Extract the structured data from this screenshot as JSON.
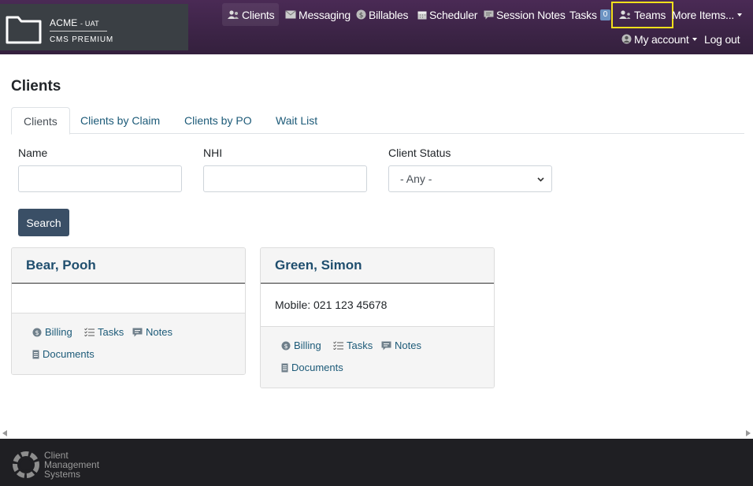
{
  "brand": {
    "org": "ACME",
    "env": "- UAT",
    "product": "CMS PREMIUM"
  },
  "nav": {
    "clients": "Clients",
    "messaging": "Messaging",
    "billables": "Billables",
    "scheduler": "Scheduler",
    "session_notes": "Session Notes",
    "tasks": "Tasks",
    "tasks_count": "0",
    "teams": "Teams",
    "more_items": "More Items...",
    "my_account": "My account",
    "log_out": "Log out"
  },
  "page": {
    "title": "Clients"
  },
  "tabs": [
    "Clients",
    "Clients by Claim",
    "Clients by PO",
    "Wait List"
  ],
  "filters": {
    "name_label": "Name",
    "name_value": "",
    "nhi_label": "NHI",
    "nhi_value": "",
    "status_label": "Client Status",
    "status_selected": "- Any -"
  },
  "search_label": "Search",
  "cards": [
    {
      "name": "Bear, Pooh",
      "detail": "",
      "links": {
        "billing": "Billing",
        "tasks": "Tasks",
        "notes": "Notes",
        "documents": "Documents"
      }
    },
    {
      "name": "Green, Simon",
      "detail": "Mobile: 021 123 45678",
      "links": {
        "billing": "Billing",
        "tasks": "Tasks",
        "notes": "Notes",
        "documents": "Documents"
      }
    }
  ],
  "footer": {
    "line1": "Client",
    "line2": "Management",
    "line3": "Systems"
  },
  "colors": {
    "navbar": "#3c2446",
    "highlight": "#f3e01c",
    "link": "#1c5a78",
    "button": "#3a4f66",
    "footer": "#1f1f23"
  }
}
